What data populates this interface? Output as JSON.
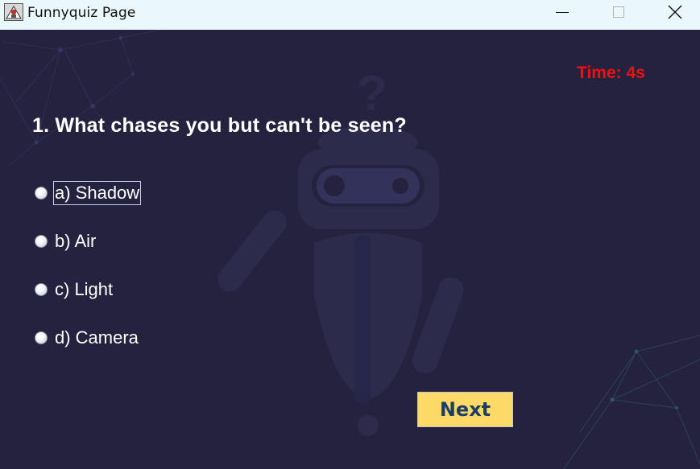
{
  "window": {
    "title": "Funnyquiz Page",
    "controls": [
      "minimize-icon",
      "maximize-icon",
      "close-icon"
    ]
  },
  "quiz": {
    "timer_text": "Time: 4s",
    "question": "1. What chases you but can't be seen?",
    "options": [
      {
        "label": "a) Shadow",
        "selected": false,
        "focused": true
      },
      {
        "label": "b) Air",
        "selected": false,
        "focused": false
      },
      {
        "label": "c) Light",
        "selected": false,
        "focused": false
      },
      {
        "label": "d) Camera",
        "selected": false,
        "focused": false
      }
    ],
    "next_label": "Next"
  },
  "colors": {
    "background": "#24223f",
    "timer": "#ee1111",
    "question": "#ffffff",
    "next_button_bg": "#fdd967",
    "next_button_text": "#1c3f66",
    "titlebar": "#eaf7fb"
  }
}
